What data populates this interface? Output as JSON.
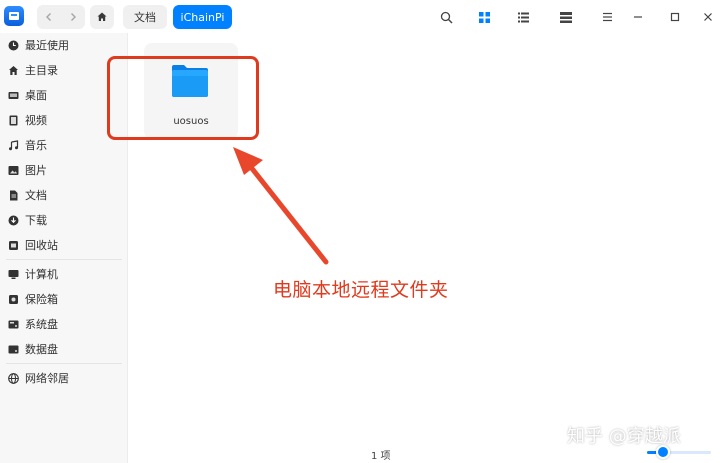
{
  "titlebar": {
    "breadcrumbs": [
      "文档",
      "iChainPi"
    ]
  },
  "sidebar": {
    "items": [
      {
        "label": "最近使用",
        "icon": "clock-icon"
      },
      {
        "label": "主目录",
        "icon": "home-icon"
      },
      {
        "label": "桌面",
        "icon": "desktop-icon"
      },
      {
        "label": "视频",
        "icon": "video-icon"
      },
      {
        "label": "音乐",
        "icon": "music-icon"
      },
      {
        "label": "图片",
        "icon": "picture-icon"
      },
      {
        "label": "文档",
        "icon": "document-icon"
      },
      {
        "label": "下载",
        "icon": "download-icon"
      },
      {
        "label": "回收站",
        "icon": "trash-icon"
      },
      {
        "label": "计算机",
        "icon": "computer-icon"
      },
      {
        "label": "保险箱",
        "icon": "vault-icon"
      },
      {
        "label": "系统盘",
        "icon": "system-disk-icon"
      },
      {
        "label": "数据盘",
        "icon": "data-disk-icon"
      },
      {
        "label": "网络邻居",
        "icon": "network-icon"
      }
    ]
  },
  "main": {
    "files": [
      {
        "name": "uosuos",
        "icon": "folder-icon"
      }
    ]
  },
  "annotation": {
    "text": "电脑本地远程文件夹",
    "color": "#e03a1e"
  },
  "status": {
    "count": "1 项"
  },
  "watermark": {
    "text": "知乎 @穿越派"
  },
  "colors": {
    "accent": "#0081ff"
  }
}
